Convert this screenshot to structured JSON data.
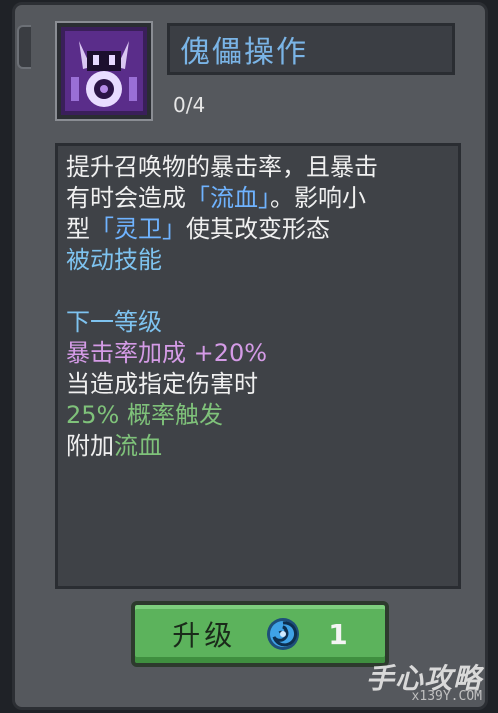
{
  "skill": {
    "icon": "puppet-skill-icon",
    "title": "傀儡操作",
    "level": "0/4"
  },
  "description": {
    "line1": "提升召唤物的暴击率，且暴击",
    "line2_a": "有时会造成",
    "line2_b": "「流血」",
    "line2_c": "。影响小",
    "line3_a": "型",
    "line3_b": "「灵卫」",
    "line3_c": "使其改变形态",
    "type": "被动技能"
  },
  "next_level": {
    "heading": "下一等级",
    "crit_bonus": "暴击率加成 +20%",
    "condition": "当造成指定伤害时",
    "chance": "25% 概率触发",
    "effect_prefix": "附加",
    "effect_name": "流血"
  },
  "upgrade_button": {
    "label": "升级",
    "currency_icon": "blue-gem-icon",
    "cost": "1"
  },
  "watermark": {
    "main": "手心攻略",
    "sub": "x139Y.COM"
  },
  "colors": {
    "panel": "#55585d",
    "title_blue": "#7ab4e6",
    "keyword_blue": "#6fb3ff",
    "crit_purple": "#d49be6",
    "chance_green": "#7fc27a",
    "button_green": "#5cb35c"
  }
}
